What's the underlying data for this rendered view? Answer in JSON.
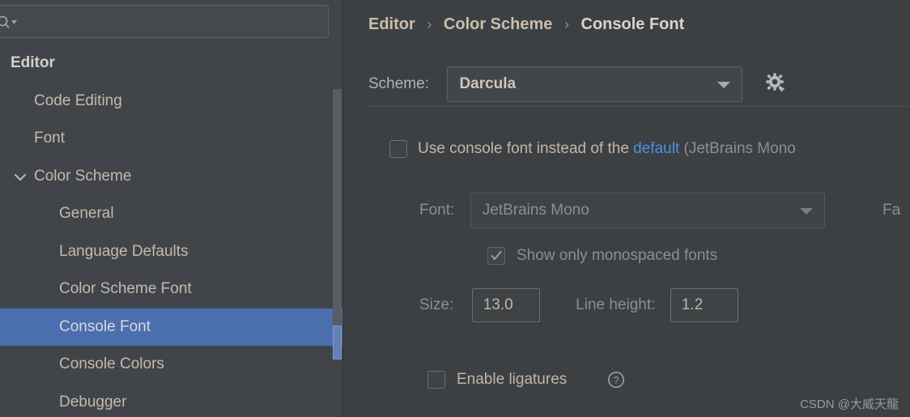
{
  "window": {
    "theme_background": "#3c4043",
    "sidebar_background": "#41454a",
    "selection_color": "#4b6eaf",
    "link_color": "#4d90e0",
    "text_color": "#c2b6a8",
    "disabled_text_color": "#8e8e8e"
  },
  "sidebar": {
    "search": {
      "value": "",
      "placeholder": "",
      "icon": "search-icon",
      "dropdown_icon": "chevron-down-icon"
    },
    "items": [
      {
        "label": "Editor",
        "level": 0,
        "expandable": false,
        "expanded": false,
        "selected": false
      },
      {
        "label": "Code Editing",
        "level": 1,
        "expandable": false,
        "expanded": false,
        "selected": false
      },
      {
        "label": "Font",
        "level": 1,
        "expandable": false,
        "expanded": false,
        "selected": false
      },
      {
        "label": "Color Scheme",
        "level": 1,
        "expandable": true,
        "expanded": true,
        "selected": false
      },
      {
        "label": "General",
        "level": 2,
        "expandable": false,
        "expanded": false,
        "selected": false
      },
      {
        "label": "Language Defaults",
        "level": 2,
        "expandable": false,
        "expanded": false,
        "selected": false
      },
      {
        "label": "Color Scheme Font",
        "level": 2,
        "expandable": false,
        "expanded": false,
        "selected": false
      },
      {
        "label": "Console Font",
        "level": 2,
        "expandable": false,
        "expanded": false,
        "selected": true
      },
      {
        "label": "Console Colors",
        "level": 2,
        "expandable": false,
        "expanded": false,
        "selected": false
      },
      {
        "label": "Debugger",
        "level": 2,
        "expandable": false,
        "expanded": false,
        "selected": false
      }
    ]
  },
  "content": {
    "breadcrumb": {
      "crumb1": "Editor",
      "crumb2": "Color Scheme",
      "crumb3": "Console Font",
      "separator": "›"
    },
    "scheme": {
      "label": "Scheme:",
      "value": "Darcula",
      "dropdown_icon": "chevron-down-icon",
      "settings_icon": "gear-dropdown-icon"
    },
    "use_console_font": {
      "checked": false,
      "text_before": "Use console font instead of the",
      "link": "default",
      "text_after": "(JetBrains Mono"
    },
    "font": {
      "label": "Font:",
      "value": "JetBrains Mono",
      "enabled": false,
      "dropdown_icon": "chevron-down-icon"
    },
    "fallback": {
      "label": "Fa"
    },
    "monospaced": {
      "checked": true,
      "enabled": false,
      "label": "Show only monospaced fonts"
    },
    "size": {
      "label": "Size:",
      "value": "13.0"
    },
    "line_height": {
      "label": "Line height:",
      "value": "1.2"
    },
    "ligatures": {
      "checked": false,
      "label": "Enable ligatures",
      "help_icon": "question-mark-icon"
    }
  },
  "watermark": {
    "text": "CSDN @大威天龍"
  }
}
